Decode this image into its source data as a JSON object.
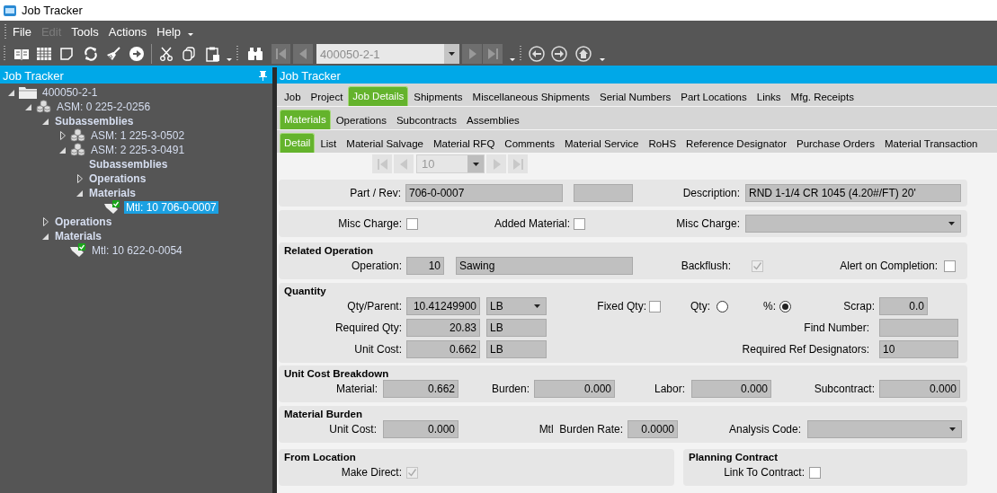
{
  "window": {
    "title": "Job Tracker"
  },
  "menu": [
    {
      "label": "File",
      "disabled": false
    },
    {
      "label": "Edit",
      "disabled": true
    },
    {
      "label": "Tools",
      "disabled": false
    },
    {
      "label": "Actions",
      "disabled": false
    },
    {
      "label": "Help",
      "disabled": false
    }
  ],
  "toolbar": {
    "record": "400050-2-1"
  },
  "tree_panel": {
    "title": "Job Tracker",
    "nodes": [
      {
        "label": "400050-2-1",
        "kind": "job",
        "expanded": true,
        "selected": false,
        "children": [
          {
            "label": "ASM: 0 225-2-0256",
            "kind": "assembly",
            "expanded": true,
            "selected": false,
            "children": [
              {
                "label": "Subassemblies",
                "kind": "group",
                "expanded": true,
                "selected": false,
                "children": [
                  {
                    "label": "ASM: 1 225-3-0502",
                    "kind": "assembly",
                    "expanded": false,
                    "selected": false
                  },
                  {
                    "label": "ASM: 2 225-3-0491",
                    "kind": "assembly",
                    "expanded": true,
                    "selected": false,
                    "children": [
                      {
                        "label": "Subassemblies",
                        "kind": "group",
                        "selected": false
                      },
                      {
                        "label": "Operations",
                        "kind": "group",
                        "expanded": false,
                        "selected": false
                      },
                      {
                        "label": "Materials",
                        "kind": "group",
                        "expanded": true,
                        "selected": false,
                        "children": [
                          {
                            "label": "Mtl: 10 706-0-0007",
                            "kind": "material",
                            "selected": true
                          }
                        ]
                      }
                    ]
                  }
                ]
              },
              {
                "label": "Operations",
                "kind": "group",
                "expanded": false,
                "selected": false
              },
              {
                "label": "Materials",
                "kind": "group",
                "expanded": true,
                "selected": false,
                "children": [
                  {
                    "label": "Mtl: 10 622-0-0054",
                    "kind": "material",
                    "selected": false
                  }
                ]
              }
            ]
          }
        ]
      }
    ]
  },
  "detail_panel": {
    "title": "Job Tracker",
    "tab_rows": [
      [
        {
          "label": "Job",
          "selected": false
        },
        {
          "label": "Project",
          "selected": false
        },
        {
          "label": "Job Details",
          "selected": true
        },
        {
          "label": "Shipments",
          "selected": false
        },
        {
          "label": "Miscellaneous Shipments",
          "selected": false
        },
        {
          "label": "Serial Numbers",
          "selected": false
        },
        {
          "label": "Part Locations",
          "selected": false
        },
        {
          "label": "Links",
          "selected": false
        },
        {
          "label": "Mfg. Receipts",
          "selected": false
        }
      ],
      [
        {
          "label": "Materials",
          "selected": true
        },
        {
          "label": "Operations",
          "selected": false
        },
        {
          "label": "Subcontracts",
          "selected": false
        },
        {
          "label": "Assemblies",
          "selected": false
        }
      ],
      [
        {
          "label": "Detail",
          "selected": true
        },
        {
          "label": "List",
          "selected": false
        },
        {
          "label": "Material Salvage",
          "selected": false
        },
        {
          "label": "Material RFQ",
          "selected": false
        },
        {
          "label": "Comments",
          "selected": false
        },
        {
          "label": "Material Service",
          "selected": false
        },
        {
          "label": "RoHS",
          "selected": false
        },
        {
          "label": "Reference Designator",
          "selected": false
        },
        {
          "label": "Purchase Orders",
          "selected": false
        },
        {
          "label": "Material Transaction",
          "selected": false
        }
      ]
    ],
    "record_nav": {
      "value": "10"
    },
    "sections": [
      {
        "rows": [
          [
            {
              "kind": "label",
              "text": "Part / Rev:"
            },
            {
              "kind": "field",
              "value": "706-0-0007"
            },
            {
              "kind": "field"
            },
            {
              "kind": "label",
              "text": "Description:"
            },
            {
              "kind": "field",
              "value": "RND 1-1/4 CR 1045 (4.20#/FT) 20'"
            }
          ]
        ]
      },
      {
        "rows": [
          [
            {
              "kind": "label",
              "text": "Misc Charge:"
            },
            {
              "kind": "check",
              "checked": false,
              "disabled": false
            },
            {
              "kind": "label",
              "text": "Added Material:"
            },
            {
              "kind": "check",
              "checked": false,
              "disabled": false
            },
            {
              "kind": "label",
              "text": "Misc Charge:"
            },
            {
              "kind": "combo"
            }
          ]
        ]
      },
      {
        "title": "Related Operation",
        "rows": [
          [
            {
              "kind": "label",
              "text": "Operation:"
            },
            {
              "kind": "field",
              "value": "10"
            },
            {
              "kind": "field",
              "value": "Sawing"
            },
            {
              "kind": "label",
              "text": "Backflush:"
            },
            {
              "kind": "check",
              "checked": true,
              "disabled": true
            },
            {
              "kind": "label",
              "text": "Alert on Completion:"
            },
            {
              "kind": "check",
              "checked": false,
              "disabled": false
            }
          ]
        ]
      },
      {
        "title": "Quantity",
        "rows": [
          [
            {
              "kind": "label",
              "text": "Qty/Parent:"
            },
            {
              "kind": "field",
              "value": "10.41249900"
            },
            {
              "kind": "combo",
              "value": "LB"
            },
            {
              "kind": "label",
              "text": "Fixed Qty:"
            },
            {
              "kind": "check",
              "checked": false,
              "disabled": false
            },
            {
              "kind": "label",
              "text": "Qty:"
            },
            {
              "kind": "radio",
              "selected": false
            },
            {
              "kind": "label",
              "text": "%:"
            },
            {
              "kind": "radio",
              "selected": true
            },
            {
              "kind": "label",
              "text": "Scrap:"
            },
            {
              "kind": "field",
              "value": "0.0"
            }
          ],
          [
            {
              "kind": "label",
              "text": "Required Qty:"
            },
            {
              "kind": "field",
              "value": "20.83"
            },
            {
              "kind": "field",
              "value": "LB"
            },
            {
              "kind": "label",
              "text": "Find Number:"
            },
            {
              "kind": "field"
            }
          ],
          [
            {
              "kind": "label",
              "text": "Unit Cost:"
            },
            {
              "kind": "field",
              "value": "0.662"
            },
            {
              "kind": "field",
              "value": "LB"
            },
            {
              "kind": "label",
              "text": "Required Ref Designators:"
            },
            {
              "kind": "field",
              "value": "10"
            }
          ]
        ]
      },
      {
        "title": "Unit Cost Breakdown",
        "rows": [
          [
            {
              "kind": "label",
              "text": "Material:"
            },
            {
              "kind": "field",
              "value": "0.662"
            },
            {
              "kind": "label",
              "text": "Burden:"
            },
            {
              "kind": "field",
              "value": "0.000"
            },
            {
              "kind": "label",
              "text": "Labor:"
            },
            {
              "kind": "field",
              "value": "0.000"
            },
            {
              "kind": "label",
              "text": "Subcontract:"
            },
            {
              "kind": "field",
              "value": "0.000"
            }
          ]
        ]
      },
      {
        "title": "Material Burden",
        "rows": [
          [
            {
              "kind": "label",
              "text": "Unit Cost:"
            },
            {
              "kind": "field",
              "value": "0.000"
            },
            {
              "kind": "label",
              "text": "Mtl  Burden Rate:"
            },
            {
              "kind": "field",
              "value": "0.0000"
            },
            {
              "kind": "label",
              "text": "Analysis Code:"
            },
            {
              "kind": "combo"
            }
          ]
        ]
      },
      {
        "title": "From Location",
        "rows": [
          [
            {
              "kind": "label",
              "text": "Make Direct:"
            },
            {
              "kind": "check",
              "checked": true,
              "disabled": true
            }
          ]
        ]
      },
      {
        "title": "Planning Contract",
        "rows": [
          [
            {
              "kind": "label",
              "text": "Link To Contract:"
            },
            {
              "kind": "check",
              "checked": false,
              "disabled": false
            }
          ]
        ]
      }
    ]
  }
}
